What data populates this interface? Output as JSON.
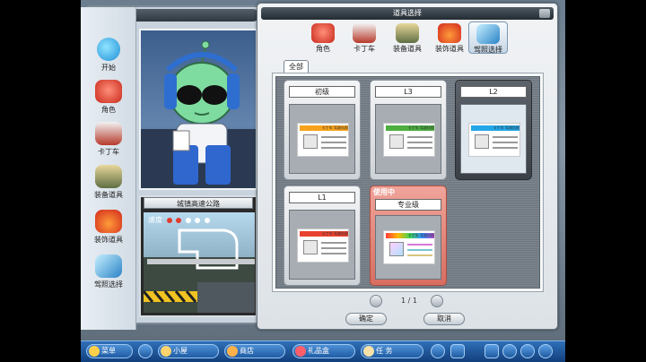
{
  "sidebar": {
    "items": [
      {
        "label": "开始"
      },
      {
        "label": "角色"
      },
      {
        "label": "卡丁车"
      },
      {
        "label": "装备道具"
      },
      {
        "label": "装饰道具"
      },
      {
        "label": "驾照选择"
      }
    ]
  },
  "track": {
    "title": "城镇高速公路",
    "speed_label": "速度"
  },
  "dialog": {
    "title": "道具选择",
    "tabs": [
      {
        "label": "角色"
      },
      {
        "label": "卡丁车"
      },
      {
        "label": "装备道具"
      },
      {
        "label": "装饰道具"
      },
      {
        "label": "驾照选择"
      }
    ],
    "active_tab": "驾照选择",
    "sub_tab": "全部",
    "cards": [
      {
        "name": "初级",
        "badge": "",
        "accent": "#f7a21b"
      },
      {
        "name": "L3",
        "badge": "",
        "accent": "#4cae3f"
      },
      {
        "name": "L2",
        "badge": "",
        "accent": "#23a7e8"
      },
      {
        "name": "L1",
        "badge": "",
        "accent": "#e8412f"
      },
      {
        "name": "专业级",
        "badge": "使用中",
        "accent": "#b44fd0"
      }
    ],
    "plate_header": "卡丁车 驾驶执照",
    "pager": {
      "text": "1 / 1"
    },
    "confirm_label": "确定",
    "cancel_label": "取消"
  },
  "bottom_bar": {
    "menu_label": "菜单",
    "home_label": "小屋",
    "shop_label": "商店",
    "gift_label": "礼品盒",
    "quest_label": "任  务"
  },
  "colors": {
    "title_bar": "#2a3239",
    "bottom_bar": "#1d56a0",
    "in_use": "#d76e61"
  }
}
